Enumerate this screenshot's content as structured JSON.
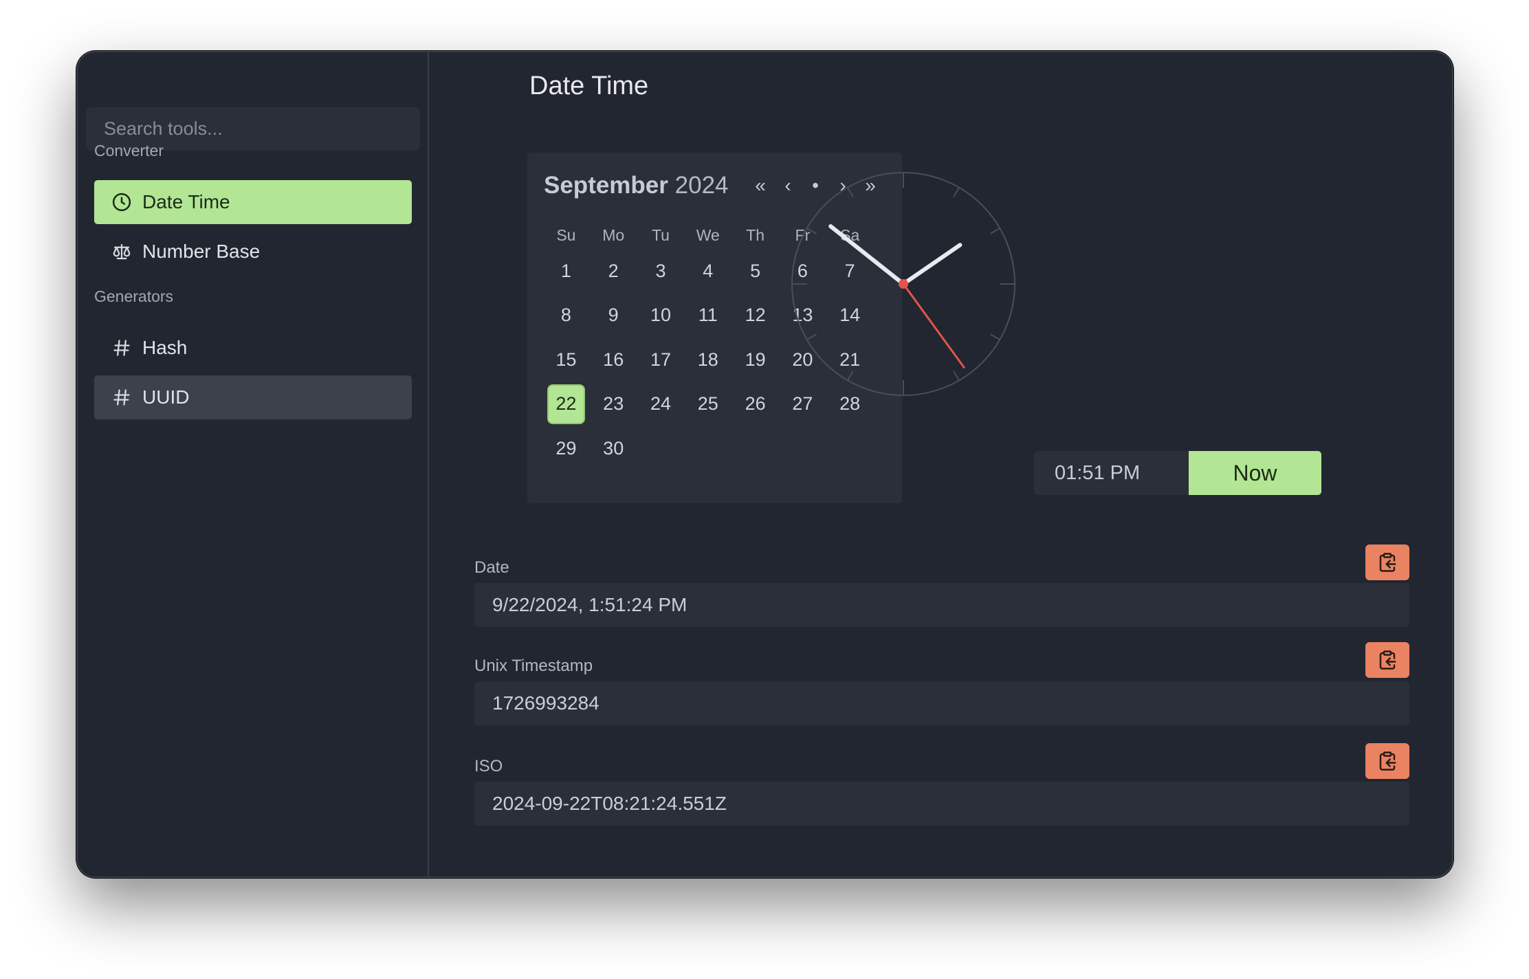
{
  "sidebar": {
    "search_placeholder": "Search tools...",
    "sections": [
      {
        "label": "Converter",
        "items": [
          {
            "label": "Date Time",
            "icon": "clock-icon",
            "active": true
          },
          {
            "label": "Number Base",
            "icon": "scale-icon"
          }
        ]
      },
      {
        "label": "Generators",
        "items": [
          {
            "label": "Hash",
            "icon": "hash-icon"
          },
          {
            "label": "UUID",
            "icon": "hash-icon",
            "hovered": true
          }
        ]
      }
    ]
  },
  "main": {
    "title": "Date Time",
    "calendar": {
      "month": "September",
      "year": "2024",
      "nav": [
        "«",
        "‹",
        "•",
        "›",
        "»"
      ],
      "weekdays": [
        "Su",
        "Mo",
        "Tu",
        "We",
        "Th",
        "Fr",
        "Sa"
      ],
      "weeks": [
        [
          "1",
          "2",
          "3",
          "4",
          "5",
          "6",
          "7"
        ],
        [
          "8",
          "9",
          "10",
          "11",
          "12",
          "13",
          "14"
        ],
        [
          "15",
          "16",
          "17",
          "18",
          "19",
          "20",
          "21"
        ],
        [
          "22",
          "23",
          "24",
          "25",
          "26",
          "27",
          "28"
        ],
        [
          "29",
          "30",
          "",
          "",
          "",
          "",
          ""
        ]
      ],
      "selected_day": "22"
    },
    "clock": {
      "hours": 13,
      "minutes": 51,
      "seconds": 24
    },
    "time_value": "01:51 PM",
    "now_label": "Now",
    "fields": [
      {
        "label": "Date",
        "value": "9/22/2024, 1:51:24 PM"
      },
      {
        "label": "Unix Timestamp",
        "value": "1726993284"
      },
      {
        "label": "ISO",
        "value": "2024-09-22T08:21:24.551Z"
      }
    ]
  },
  "colors": {
    "accent": "#b2e594",
    "copy_button": "#ea8361",
    "second_hand": "#e4544c",
    "background": "#222630"
  }
}
